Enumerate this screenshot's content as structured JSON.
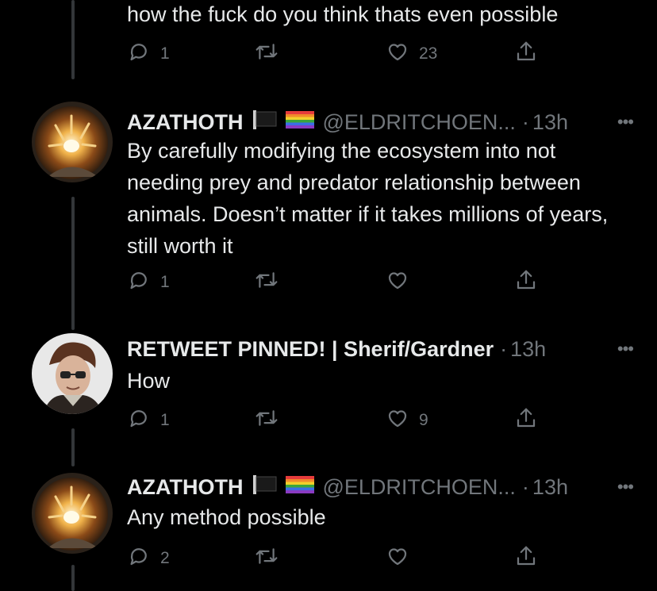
{
  "top_tweet": {
    "text": "how the fuck do you think thats even possible",
    "reply_count": "1",
    "retweet_count": "",
    "like_count": "23"
  },
  "tweets": [
    {
      "name": "AZATHOTH",
      "handle": "@ELDRITCHOEN...",
      "dot": "·",
      "time": "13h",
      "text": "By carefully modifying the ecosystem into not needing prey and predator relationship between animals. Doesn’t matter if it takes millions of years, still worth it",
      "reply_count": "1",
      "retweet_count": "",
      "like_count": ""
    },
    {
      "name": "RETWEET PINNED! | Sherif/Gardner",
      "handle": "",
      "dot": "·",
      "time": "13h",
      "text": "How",
      "reply_count": "1",
      "retweet_count": "",
      "like_count": "9"
    },
    {
      "name": "AZATHOTH",
      "handle": "@ELDRITCHOEN...",
      "dot": "·",
      "time": "13h",
      "text": "Any method possible",
      "reply_count": "2",
      "retweet_count": "",
      "like_count": ""
    }
  ],
  "icons": {
    "reply": "reply-icon",
    "retweet": "retweet-icon",
    "like": "heart-icon",
    "share": "share-icon",
    "more": "more-icon",
    "flags": [
      "black-flag-icon",
      "rainbow-flag-icon"
    ]
  },
  "colors": {
    "background": "#000000",
    "text": "#e7e9ea",
    "secondary": "#71767b",
    "thread_line": "#333639"
  },
  "more_label": "•••"
}
